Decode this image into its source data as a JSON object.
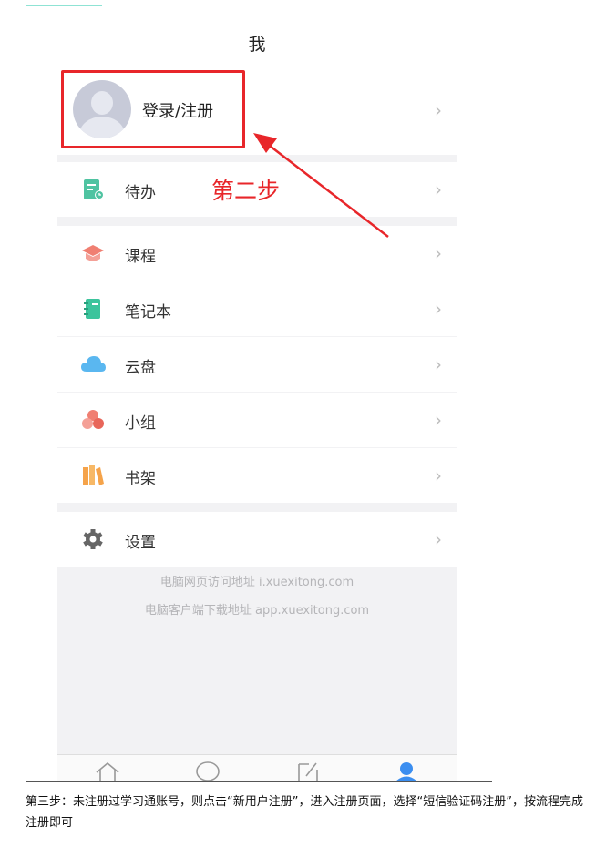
{
  "header": {
    "title": "我"
  },
  "profile": {
    "label": "登录/注册",
    "avatar_icon": "default-avatar-icon"
  },
  "menu": [
    {
      "label": "待办",
      "icon": "todo-icon",
      "color": "#4fc3a1"
    },
    {
      "label": "课程",
      "icon": "course-icon",
      "color": "#f07f72"
    },
    {
      "label": "笔记本",
      "icon": "notebook-icon",
      "color": "#3cc49c"
    },
    {
      "label": "云盘",
      "icon": "cloud-icon",
      "color": "#5ab7f0"
    },
    {
      "label": "小组",
      "icon": "group-icon",
      "color": "#f07f72"
    },
    {
      "label": "书架",
      "icon": "bookshelf-icon",
      "color": "#f5a34a"
    },
    {
      "label": "设置",
      "icon": "gear-icon",
      "color": "#666666"
    }
  ],
  "footer": {
    "line1": "电脑网页访问地址 i.xuexitong.com",
    "line2": "电脑客户端下载地址 app.xuexitong.com"
  },
  "tabbar": [
    {
      "icon": "home-icon"
    },
    {
      "icon": "message-icon"
    },
    {
      "icon": "note-edit-icon"
    },
    {
      "icon": "me-icon",
      "active": true
    }
  ],
  "annotation": {
    "text": "第二步",
    "color": "#e8262a"
  },
  "caption": "第三步：未注册过学习通账号，则点击“新用户注册”，进入注册页面，选择“短信验证码注册”，按流程完成注册即可"
}
